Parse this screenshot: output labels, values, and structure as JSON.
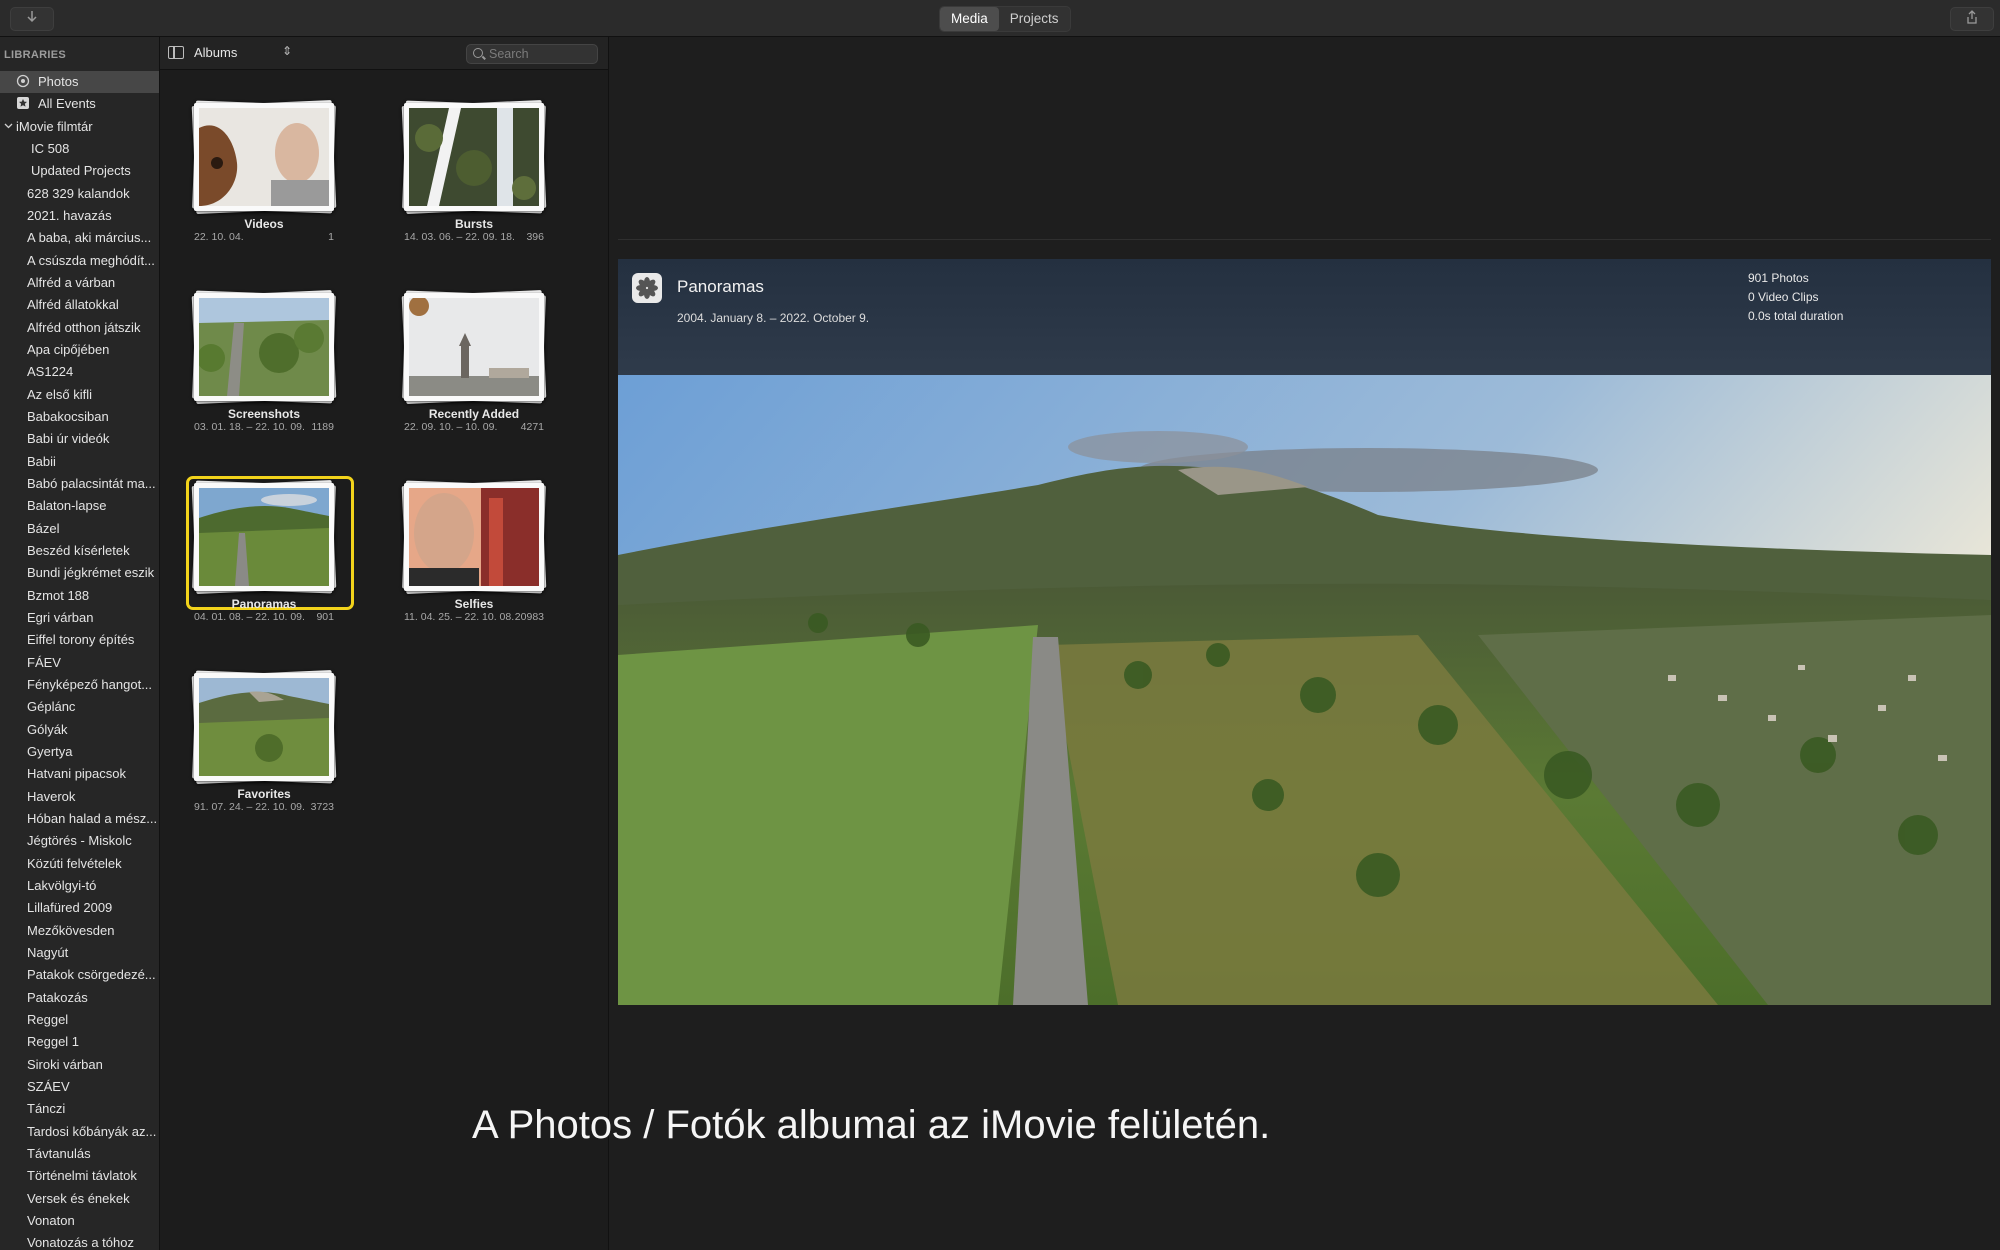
{
  "toolbar": {
    "tabs": [
      {
        "label": "Media",
        "active": true
      },
      {
        "label": "Projects",
        "active": false
      }
    ],
    "icons": {
      "left": "download-arrow-icon",
      "right": "share-icon"
    }
  },
  "sidebar": {
    "heading": "LIBRARIES",
    "items": [
      {
        "label": "Photos",
        "selected": true,
        "icon": "photos-icon"
      },
      {
        "label": "All Events",
        "icon": "star-event-icon"
      },
      {
        "label": "iMovie filmtár",
        "icon": "chevron-down-icon"
      },
      {
        "label": "IC 508"
      },
      {
        "label": "Updated Projects"
      },
      {
        "label": "628 329 kalandok"
      },
      {
        "label": "2021. havazás"
      },
      {
        "label": "A baba, aki március..."
      },
      {
        "label": "A csúszda meghódít..."
      },
      {
        "label": "Alfréd a várban"
      },
      {
        "label": "Alfréd állatokkal"
      },
      {
        "label": "Alfréd otthon játszik"
      },
      {
        "label": "Apa cipőjében"
      },
      {
        "label": "AS1224"
      },
      {
        "label": "Az első kifli"
      },
      {
        "label": "Babakocsiban"
      },
      {
        "label": "Babi úr videók"
      },
      {
        "label": "Babii"
      },
      {
        "label": "Babó palacsintát ma..."
      },
      {
        "label": "Balaton-lapse"
      },
      {
        "label": "Bázel"
      },
      {
        "label": "Beszéd kísérletek"
      },
      {
        "label": "Bundi jégkrémet eszik"
      },
      {
        "label": "Bzmot 188"
      },
      {
        "label": "Egri várban"
      },
      {
        "label": "Eiffel torony építés"
      },
      {
        "label": "FÁEV"
      },
      {
        "label": "Fényképező hangot..."
      },
      {
        "label": "Géplánc"
      },
      {
        "label": "Gólyák"
      },
      {
        "label": "Gyertya"
      },
      {
        "label": "Hatvani pipacsok"
      },
      {
        "label": "Haverok"
      },
      {
        "label": "Hóban halad a mész..."
      },
      {
        "label": "Jégtörés - Miskolc"
      },
      {
        "label": "Közúti felvételek"
      },
      {
        "label": "Lakvölgyi-tó"
      },
      {
        "label": "Lillafüred 2009"
      },
      {
        "label": "Mezőkövesden"
      },
      {
        "label": "Nagyút"
      },
      {
        "label": "Patakok csörgedezé..."
      },
      {
        "label": "Patakozás"
      },
      {
        "label": "Reggel"
      },
      {
        "label": "Reggel 1"
      },
      {
        "label": "Siroki várban"
      },
      {
        "label": "SZÁEV"
      },
      {
        "label": "Tánczi"
      },
      {
        "label": "Tardosi kőbányák az..."
      },
      {
        "label": "Távtanulás"
      },
      {
        "label": "Történelmi távlatok"
      },
      {
        "label": "Versek és énekek"
      },
      {
        "label": "Vonaton"
      },
      {
        "label": "Vonatozás a tóhoz"
      }
    ]
  },
  "browser": {
    "dropdown_label": "Albums",
    "search_placeholder": "Search",
    "albums": [
      {
        "name": "Videos",
        "date": "22. 10. 04.",
        "count": "1"
      },
      {
        "name": "Bursts",
        "date": "14. 03. 06. – 22. 09. 18.",
        "count": "396"
      },
      {
        "name": "Screenshots",
        "date": "03. 01. 18. – 22. 10. 09.",
        "count": "1189"
      },
      {
        "name": "Recently Added",
        "date": "22. 09. 10. – 10. 09.",
        "count": "4271"
      },
      {
        "name": "Panoramas",
        "date": "04. 01. 08. – 22. 10. 09.",
        "count": "901",
        "selected": true
      },
      {
        "name": "Selfies",
        "date": "11. 04. 25. – 22. 10. 08.",
        "count": "20983"
      },
      {
        "name": "Favorites",
        "date": "91. 07. 24. – 22. 10. 09.",
        "count": "3723"
      }
    ]
  },
  "viewer": {
    "title": "Panoramas",
    "date_range": "2004. January 8. – 2022. October 9.",
    "stats": [
      "901 Photos",
      "0 Video Clips",
      "0.0s total duration"
    ]
  },
  "caption": "A Photos / Fotók albumai az iMovie felületén.",
  "colors": {
    "selection": "#f2d31b",
    "sidebar_selected": "#474747",
    "background": "#1e1e1e"
  }
}
